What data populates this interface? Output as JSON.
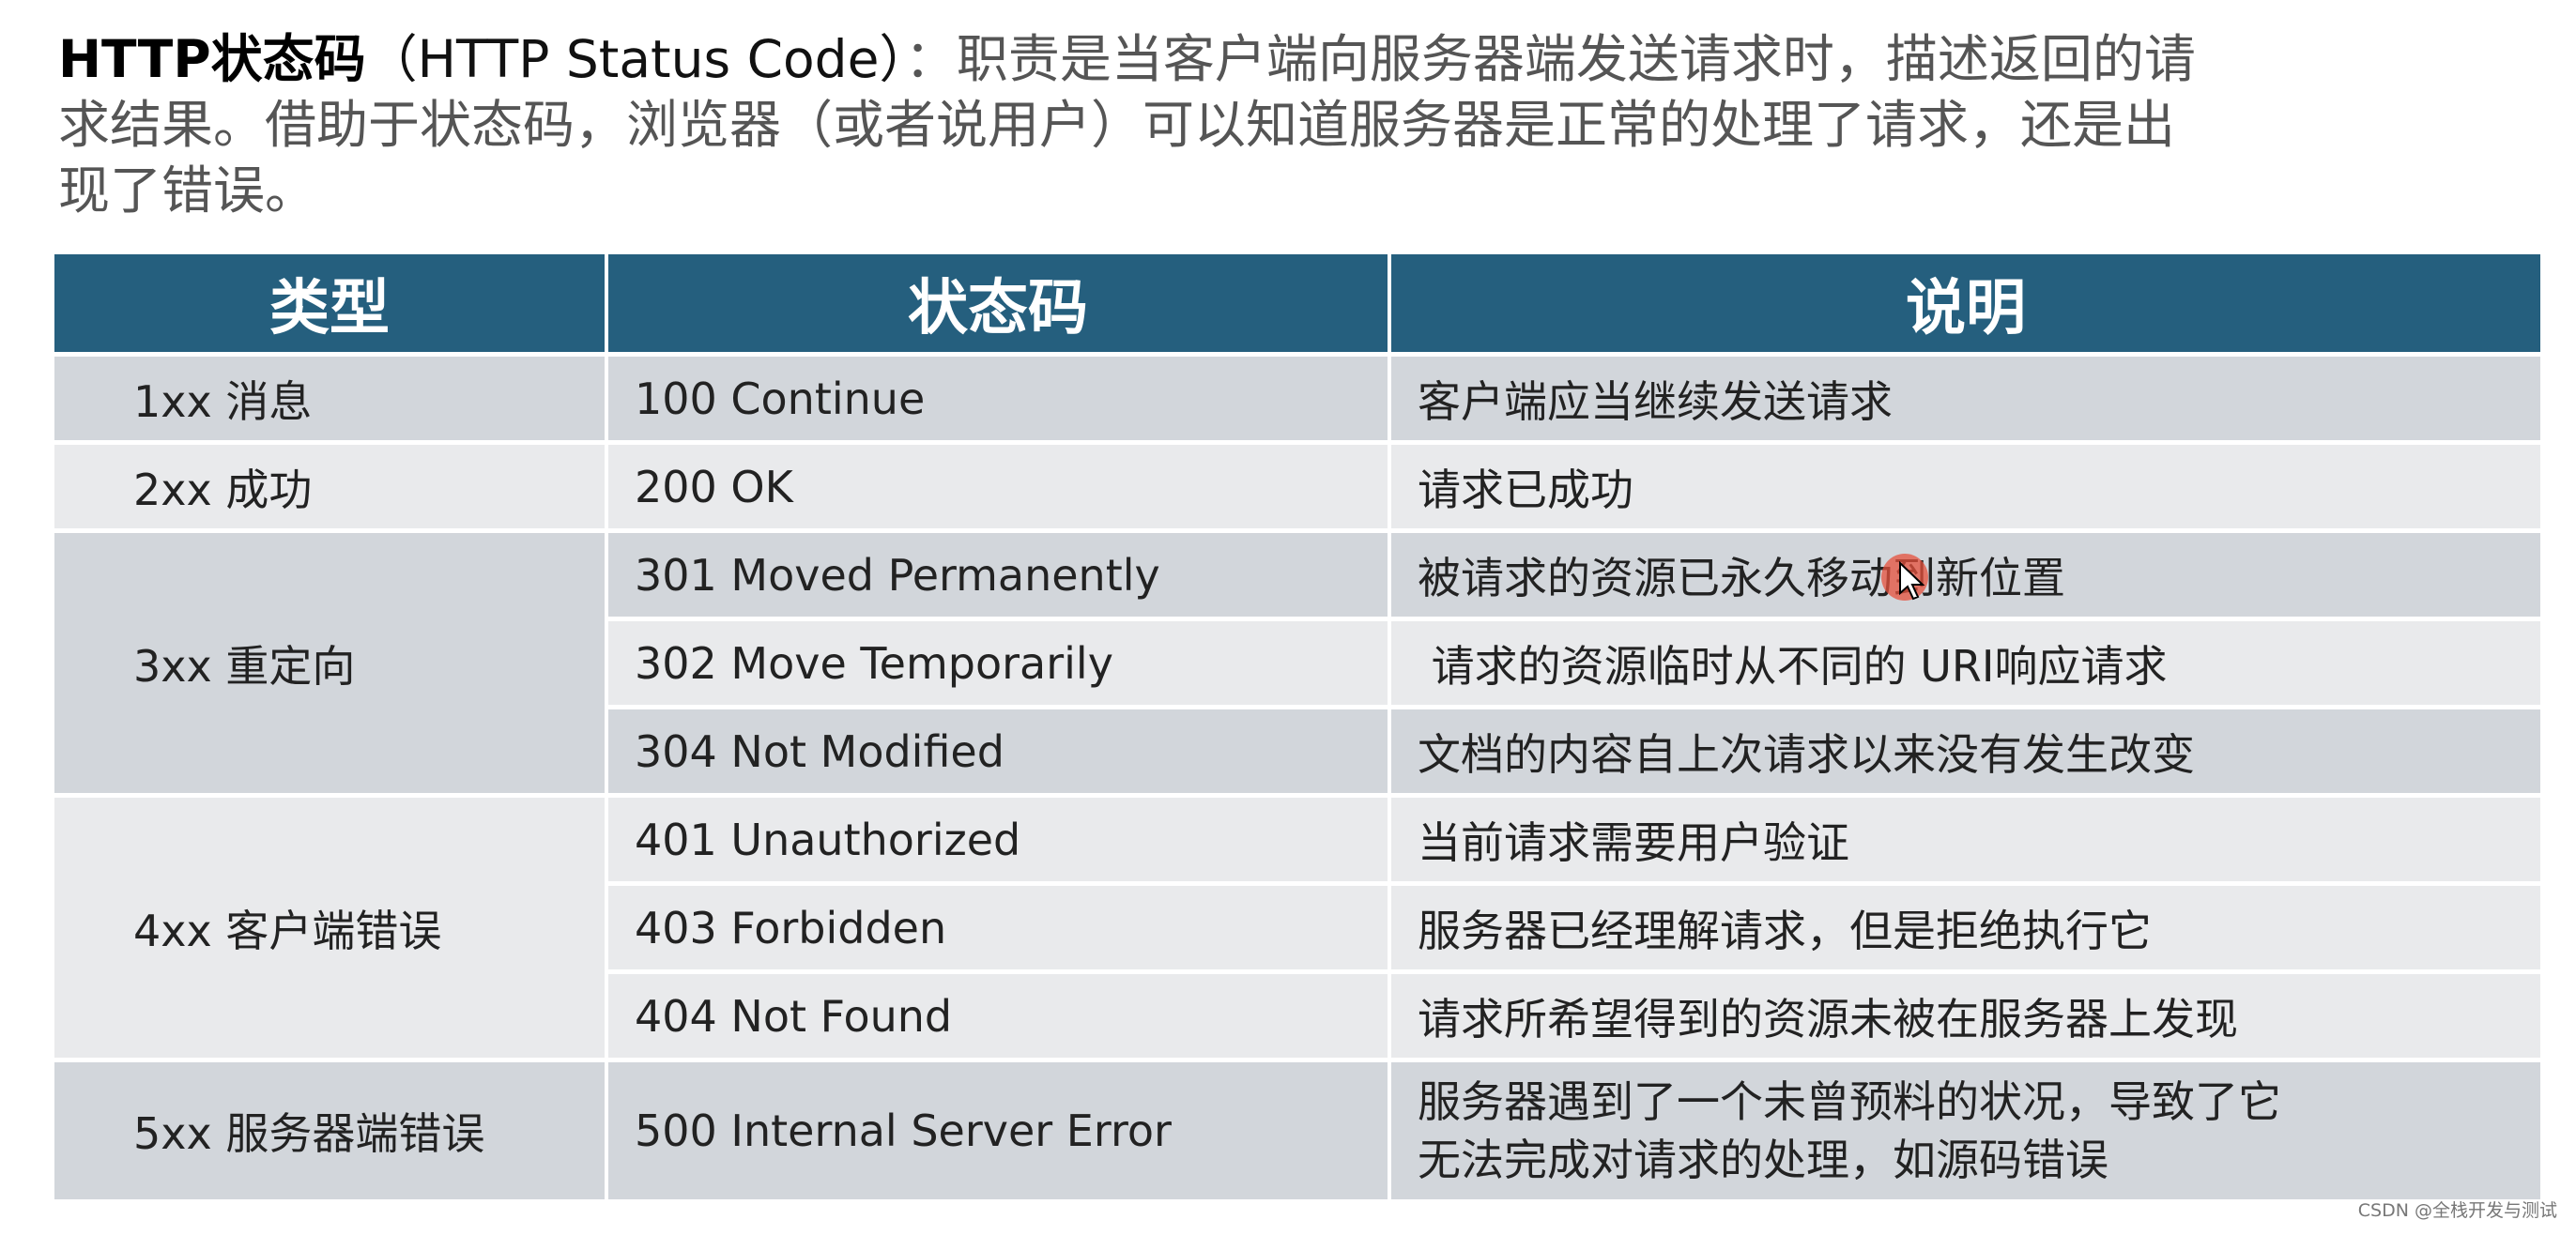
{
  "intro": {
    "title_bold": "HTTP状态码",
    "title_en": "（HTTP Status Code）",
    "line1_rest": "：职责是当客户端向服务器端发送请求时，描述返回的请",
    "line2": "求结果。借助于状态码，浏览器（或者说用户）可以知道服务器是正常的处理了请求，还是出",
    "line3": "现了错误。"
  },
  "table": {
    "headers": [
      "类型",
      "状态码",
      "说明"
    ],
    "groups": [
      {
        "type": "1xx 消息",
        "rows": [
          {
            "code": "100 Continue",
            "desc": "客户端应当继续发送请求"
          }
        ]
      },
      {
        "type": "2xx 成功",
        "rows": [
          {
            "code": "200 OK",
            "desc": "请求已成功"
          }
        ]
      },
      {
        "type": "3xx 重定向",
        "rows": [
          {
            "code": "301 Moved Permanently",
            "desc": "被请求的资源已永久移动到新位置"
          },
          {
            "code": "302 Move Temporarily",
            "desc": " 请求的资源临时从不同的 URI响应请求"
          },
          {
            "code": "304 Not Modified",
            "desc": "文档的内容自上次请求以来没有发生改变"
          }
        ]
      },
      {
        "type": "4xx 客户端错误",
        "rows": [
          {
            "code": "401 Unauthorized",
            "desc": "当前请求需要用户验证"
          },
          {
            "code": "403 Forbidden",
            "desc": "服务器已经理解请求，但是拒绝执行它"
          },
          {
            "code": "404 Not Found",
            "desc": "请求所希望得到的资源未被在服务器上发现"
          }
        ]
      },
      {
        "type": "5xx 服务器端错误",
        "rows": [
          {
            "code": "500 Internal Server Error",
            "desc_line1": "服务器遇到了一个未曾预料的状况，导致了它",
            "desc_line2": "无法完成对请求的处理，如源码错误"
          }
        ]
      }
    ]
  },
  "watermark": "CSDN @全栈开发与测试",
  "colors": {
    "header_bg": "#255f7e",
    "row_dark": "#d2d6db",
    "row_light": "#e9eaec",
    "cursor_highlight": "#e6503c"
  }
}
